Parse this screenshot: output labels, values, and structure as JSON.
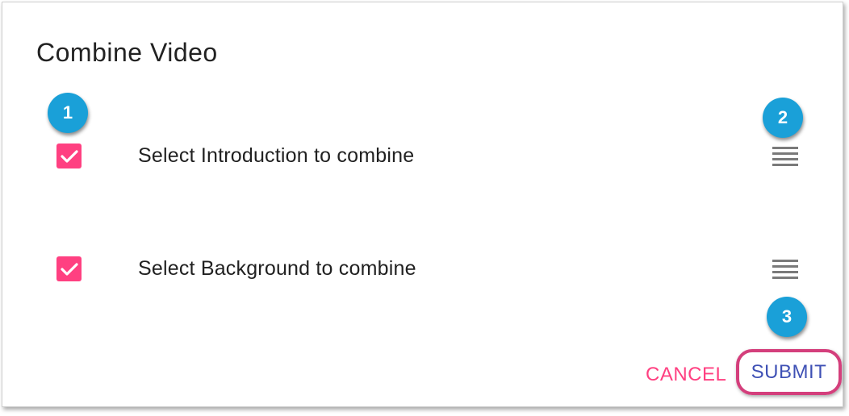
{
  "dialog": {
    "title": "Combine Video",
    "items": [
      {
        "label": "Select Introduction to combine",
        "checked": true
      },
      {
        "label": "Select Background to combine",
        "checked": true
      }
    ],
    "actions": {
      "cancel_label": "CANCEL",
      "submit_label": "SUBMIT"
    }
  },
  "badges": [
    "1",
    "2",
    "3"
  ],
  "colors": {
    "checkbox": "#ff4081",
    "cancel": "#ff4081",
    "submit": "#3f51b5",
    "badge": "#1aa0d8",
    "highlight": "#d43f7c"
  }
}
